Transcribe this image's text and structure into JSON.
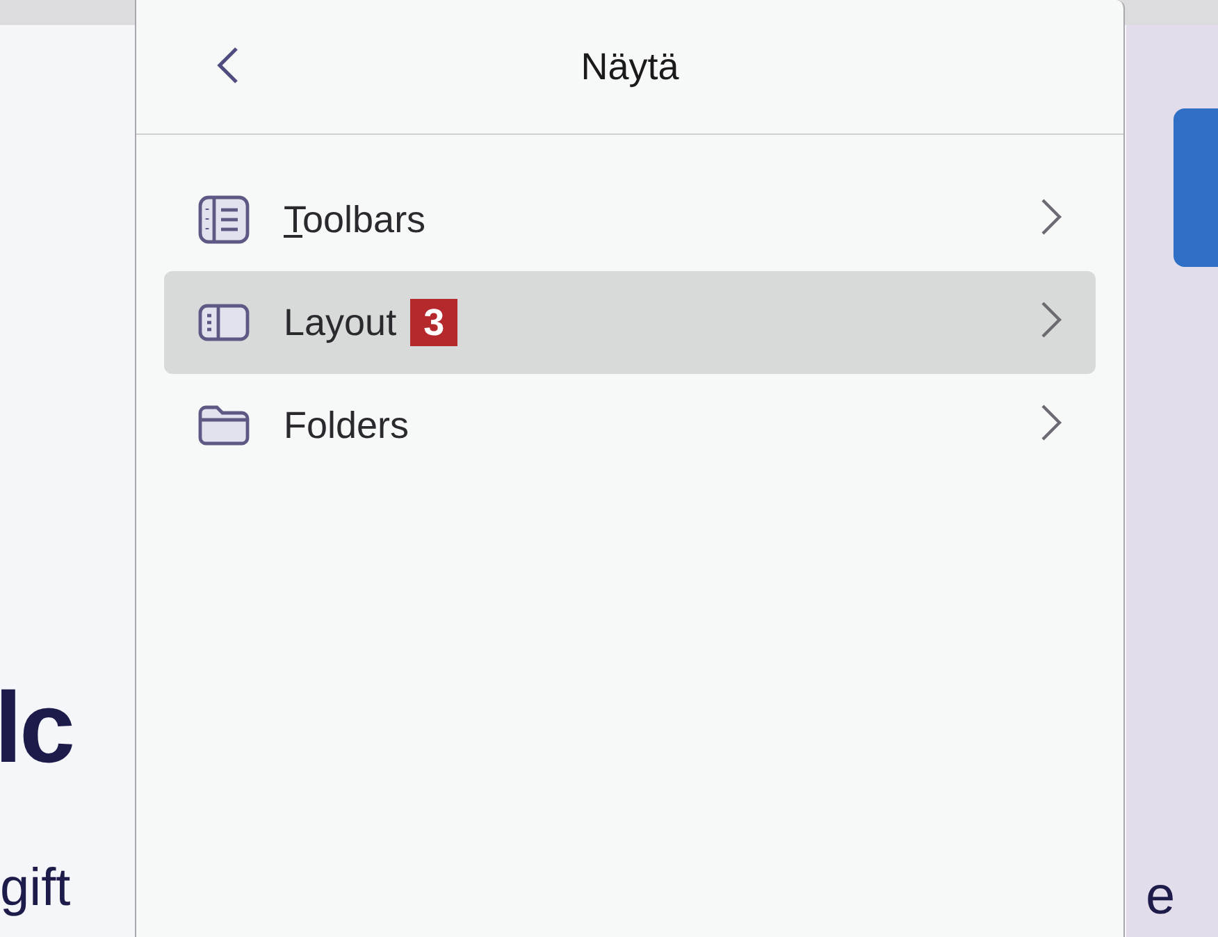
{
  "background": {
    "heading": "lc",
    "text": "gift",
    "right_text": "e"
  },
  "menu": {
    "title": "Näytä",
    "items": [
      {
        "kind": "toolbars",
        "label": "Toolbars",
        "underline_first": true,
        "selected": false
      },
      {
        "kind": "layout",
        "label": "Layout",
        "underline_first": false,
        "selected": true,
        "badge": "3"
      },
      {
        "kind": "folders",
        "label": "Folders",
        "underline_first": false,
        "selected": false
      }
    ]
  }
}
